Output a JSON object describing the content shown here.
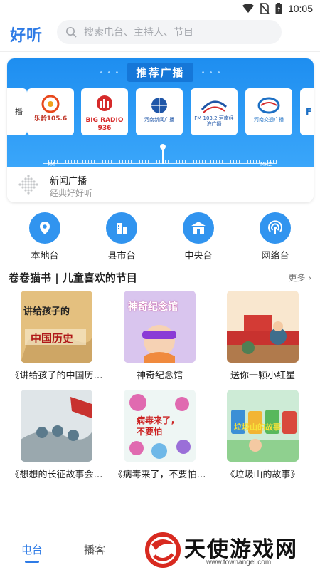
{
  "status": {
    "time": "10:05"
  },
  "header": {
    "logo": "好听",
    "search_placeholder": "搜索电台、主持人、节目"
  },
  "featured": {
    "title": "推荐广播",
    "station_logos": [
      {
        "label": "播",
        "name": "partial-left"
      },
      {
        "label": "乐龄105.6",
        "name": "leling"
      },
      {
        "label": "BIG RADIO 936",
        "name": "big-radio"
      },
      {
        "label": "河南新闻广播",
        "name": "henan-news"
      },
      {
        "label": "FM 103.2 河南经济广播",
        "name": "henan-economy"
      },
      {
        "label": "河南交通广播",
        "name": "henan-traffic"
      },
      {
        "label": "F",
        "name": "partial-right"
      }
    ],
    "tuner": {
      "left_label": "FM",
      "right_label": "MHZ"
    },
    "now_playing": {
      "name": "新闻广播",
      "subtitle": "经典好好听"
    }
  },
  "categories": [
    {
      "label": "本地台",
      "icon": "location-pin-icon"
    },
    {
      "label": "县市台",
      "icon": "building-icon"
    },
    {
      "label": "中央台",
      "icon": "gate-building-icon"
    },
    {
      "label": "网络台",
      "icon": "broadcast-signal-icon"
    }
  ],
  "section": {
    "title": "卷卷猫书 | 儿童喜欢的节目",
    "more": "更多 ›"
  },
  "programs": [
    {
      "title": "《讲给孩子的中国历…",
      "cover_text": "讲给孩子的 中国历史"
    },
    {
      "title": "神奇纪念馆",
      "cover_text": "神奇纪念馆"
    },
    {
      "title": "送你一颗小红星",
      "cover_text": ""
    },
    {
      "title": "《想想的长征故事会…",
      "cover_text": ""
    },
    {
      "title": "《病毒来了，不要怕…",
      "cover_text": "病毒来了， 不要怕"
    },
    {
      "title": "《垃圾山的故事》",
      "cover_text": "垃圾山的故事"
    }
  ],
  "tabbar": {
    "tabs": [
      "电台",
      "播客"
    ],
    "active": "电台"
  },
  "watermark": {
    "text": "天使游戏网",
    "url": "www.townangel.com"
  },
  "colors": {
    "brand": "#2e7be6",
    "banner": "#2196f3",
    "category": "#3194ef"
  }
}
